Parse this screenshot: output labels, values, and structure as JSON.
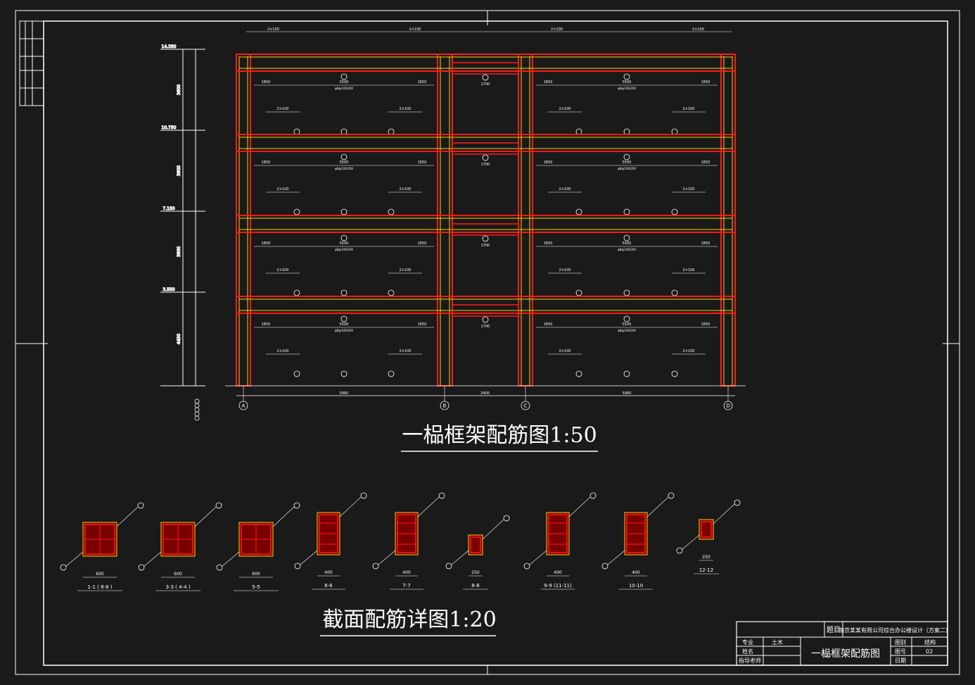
{
  "colors": {
    "background": "#1a1a1a",
    "line_white": "#ffffff",
    "rebar_red": "#ff1a1a",
    "rebar_yellow": "#ffd200"
  },
  "drawing": {
    "main_title": "一榀框架配筋图1:50",
    "section_title": "截面配筋详图1:20"
  },
  "elevations": [
    "14.350",
    "10.750",
    "7.150",
    "3.550"
  ],
  "left_dims": [
    "3600",
    "3600",
    "3600",
    "4450"
  ],
  "axes": [
    "A",
    "B",
    "C",
    "D"
  ],
  "bay_dims": [
    "5960",
    "2400",
    "5960"
  ],
  "beam_labels": {
    "top_span": "2×100",
    "mid_span": "5500",
    "side_span": "1850",
    "corridor": "1700",
    "stirrup": "φ8@100/200"
  },
  "sections": [
    {
      "label": "1-1 ( 8-8 )",
      "width": "600"
    },
    {
      "label": "3-3 ( 4-4 )",
      "width": "600"
    },
    {
      "label": "5-5",
      "width": "600"
    },
    {
      "label": "6-6",
      "width": "400"
    },
    {
      "label": "7-7",
      "width": "400"
    },
    {
      "label": "8-8",
      "width": "250"
    },
    {
      "label": "9-9 (11-11)",
      "width": "400"
    },
    {
      "label": "10-10",
      "width": "400"
    },
    {
      "label": "12-12",
      "width": "250"
    }
  ],
  "title_block": {
    "project_label": "题目",
    "project_name": "南京某某有限公司综合办公楼设计（方案二）",
    "major_label": "专业",
    "major_value": "土木",
    "name_label": "姓名",
    "teacher_label": "指导老师",
    "drawing_name": "一榀框架配筋图",
    "type_label": "图别",
    "type_value": "结构",
    "no_label": "图号",
    "no_value": "02",
    "date_label": "日期"
  }
}
